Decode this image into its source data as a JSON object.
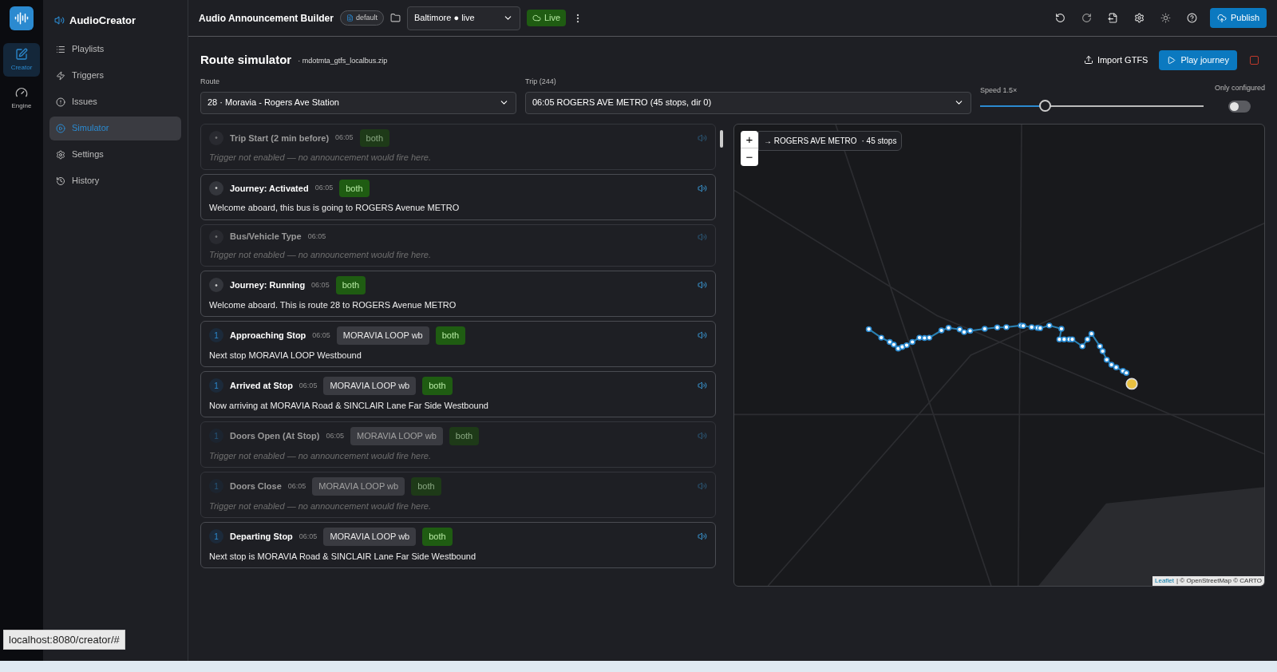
{
  "rail": [
    {
      "label": "Creator",
      "kind": "edit",
      "selected": true
    },
    {
      "label": "Engine",
      "kind": "gauge",
      "selected": false
    }
  ],
  "app": {
    "name": "AudioCreator"
  },
  "nav": [
    {
      "label": "Playlists",
      "kind": "list",
      "selected": false
    },
    {
      "label": "Triggers",
      "kind": "bolt",
      "selected": false
    },
    {
      "label": "Issues",
      "kind": "alert",
      "selected": false
    },
    {
      "label": "Simulator",
      "kind": "play",
      "selected": true
    },
    {
      "label": "Settings",
      "kind": "gear",
      "selected": false
    },
    {
      "label": "History",
      "kind": "history",
      "selected": false
    }
  ],
  "topbar": {
    "title": "Audio Announcement Builder",
    "badge": "default",
    "project": "Baltimore ● live",
    "live": "Live",
    "publish": "Publish"
  },
  "page": {
    "title": "Route simulator",
    "file": "· mdotmta_gtfs_localbus.zip",
    "import": "Import GTFS",
    "play": "Play journey"
  },
  "route": {
    "label": "Route",
    "value": "28 · Moravia - Rogers Ave Station"
  },
  "trip": {
    "label": "Trip (244)",
    "value": "06:05 ROGERS AVE METRO (45 stops, dir 0)"
  },
  "speed": {
    "label": "Speed 1.5×",
    "level": 0.29
  },
  "only_configured": {
    "label": "Only configured",
    "on": false
  },
  "events": [
    {
      "marker": "•",
      "title": "Trip Start (2 min before)",
      "time": "06:05",
      "mode": "both",
      "enabled": false,
      "message": "Trigger not enabled — no announcement would fire here."
    },
    {
      "marker": "•",
      "title": "Journey: Activated",
      "time": "06:05",
      "mode": "both",
      "enabled": true,
      "message": "Welcome aboard, this bus is going to ROGERS Avenue METRO"
    },
    {
      "marker": "•",
      "title": "Bus/Vehicle Type",
      "time": "06:05",
      "enabled": false,
      "message": "Trigger not enabled — no announcement would fire here."
    },
    {
      "marker": "•",
      "title": "Journey: Running",
      "time": "06:05",
      "mode": "both",
      "enabled": true,
      "message": "Welcome aboard. This is route 28 to ROGERS Avenue METRO"
    },
    {
      "marker": "1",
      "title": "Approaching Stop",
      "time": "06:05",
      "stop": "MORAVIA LOOP wb",
      "mode": "both",
      "enabled": true,
      "message": "Next stop MORAVIA LOOP Westbound"
    },
    {
      "marker": "1",
      "title": "Arrived at Stop",
      "time": "06:05",
      "stop": "MORAVIA LOOP wb",
      "mode": "both",
      "enabled": true,
      "message": "Now arriving at MORAVIA Road & SINCLAIR Lane Far Side Westbound"
    },
    {
      "marker": "1",
      "title": "Doors Open (At Stop)",
      "time": "06:05",
      "stop": "MORAVIA LOOP wb",
      "mode": "both",
      "enabled": false,
      "message": "Trigger not enabled — no announcement would fire here."
    },
    {
      "marker": "1",
      "title": "Doors Close",
      "time": "06:05",
      "stop": "MORAVIA LOOP wb",
      "mode": "both",
      "enabled": false,
      "message": "Trigger not enabled — no announcement would fire here."
    },
    {
      "marker": "1",
      "title": "Departing Stop",
      "time": "06:05",
      "stop": "MORAVIA LOOP wb",
      "mode": "both",
      "enabled": true,
      "message": "Next stop is MORAVIA Road & SINCLAIR Lane Far Side Westbound"
    }
  ],
  "map": {
    "zoom_in": "+",
    "zoom_out": "−",
    "caption": "→ ROGERS AVE METRO",
    "stops": "· 45 stops",
    "leaflet": "Leaflet",
    "attribution": "| © OpenStreetMap © CARTO"
  },
  "status_url": "localhost:8080/creator/#"
}
